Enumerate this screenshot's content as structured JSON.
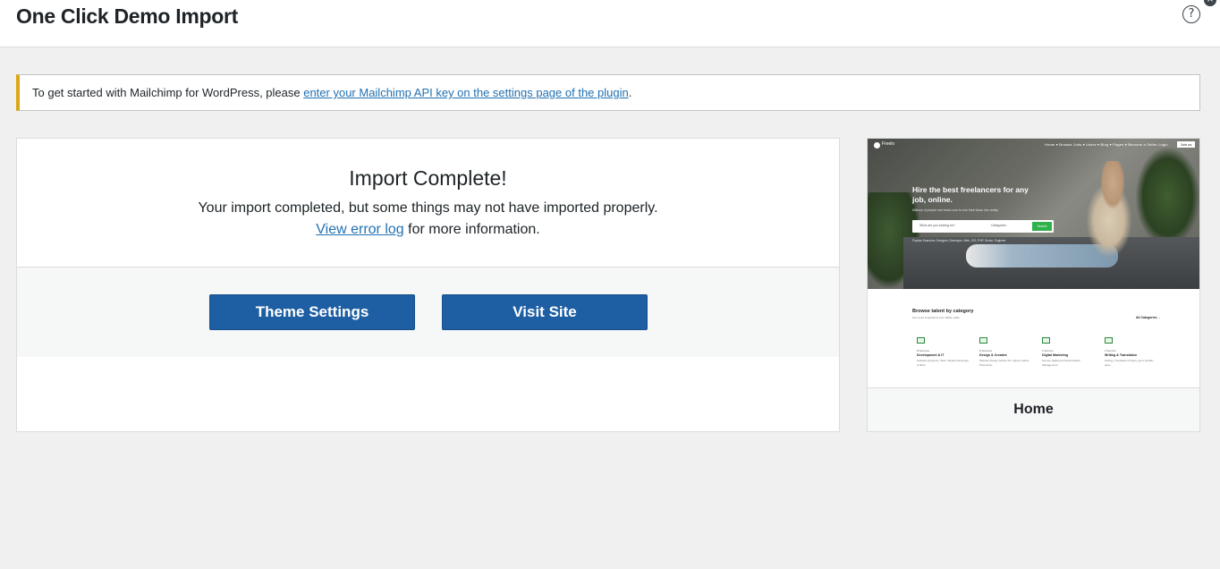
{
  "header": {
    "title": "One Click Demo Import",
    "help_icon": "?",
    "close_icon": "×"
  },
  "notice": {
    "text": "To get started with Mailchimp for WordPress, please ",
    "link_text": "enter your Mailchimp API key on the settings page of the plugin",
    "suffix": ".",
    "accent_color": "#dba617"
  },
  "import_card": {
    "heading": "Import Complete!",
    "message": "Your import completed, but some things may not have imported properly.",
    "error_link": "View error log",
    "error_suffix": " for more information.",
    "buttons": {
      "theme_settings": "Theme Settings",
      "visit_site": "Visit Site"
    },
    "button_color": "#1e5ea3"
  },
  "preview": {
    "name": "Home",
    "mini_site": {
      "brand": "Freelo",
      "nav": "Home ▾   Browse Jobs ▾   Users ▾   Blog ▾   Pages ▾          Become a Seller   Login",
      "join": "Join us",
      "headline": "Hire the best freelancers for any job, online.",
      "subheadline": "Millions of people use freelo.com to turn their ideas into reality.",
      "search_placeholder": "What are you looking for?",
      "search_category": "Categories",
      "search_button": "Search",
      "popular": "Popular Searches: Designer, Developer, Web, IOS, PHP, Senior, Engineer",
      "browse_title": "Browse talent by category",
      "browse_sub": "Get some Inspirations from 1800+ skills",
      "all_categories": "All Categories →",
      "categories": [
        {
          "count": "8 Services",
          "title": "Development & IT",
          "desc": "Software Engineer, Web / Mobile Developer & More"
        },
        {
          "count": "8 Services",
          "title": "Design & Creative",
          "desc": "Website Design Adobe XD, Figma, Adobe Photoshop"
        },
        {
          "count": "2 Service",
          "title": "Digital Marketing",
          "desc": "Service digital and Social Media Management"
        },
        {
          "count": "2 Service",
          "title": "Writing & Translation",
          "desc": "Writing, Translation Project, get it Quickly done"
        }
      ]
    }
  }
}
